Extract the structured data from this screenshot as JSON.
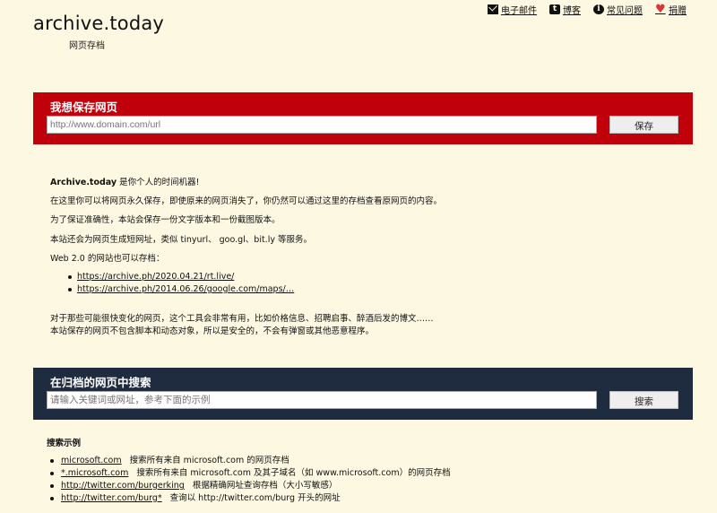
{
  "logo": {
    "title": "archive.today",
    "subtitle": "网页存档"
  },
  "topnav": [
    {
      "icon": "mail-icon",
      "label": "电子邮件"
    },
    {
      "icon": "tumblr-icon",
      "label": "博客"
    },
    {
      "icon": "info-icon",
      "label": "常见问题"
    },
    {
      "icon": "heart-icon",
      "label": "捐赠"
    }
  ],
  "save_panel": {
    "title": "我想保存网页",
    "placeholder": "http://www.domain.com/url",
    "button": "保存",
    "color": "#c0000b"
  },
  "intro": {
    "line1_bold": "Archive.today",
    "line1_rest": " 是你个人的时间机器!",
    "line2": "在这里你可以将网页永久保存，即使原来的网页消失了，你仍然可以通过这里的存档查看原网页的内容。",
    "line3": "为了保证准确性，本站会保存一份文字版本和一份截图版本。",
    "line4": "本站还会为网页生成短网址，类似 tinyurl、 goo.gl、bit.ly 等服务。",
    "line5": "Web 2.0 的网站也可以存档：",
    "links": [
      "https://archive.ph/2020.04.21/rt.live/",
      "https://archive.ph/2014.06.26/google.com/maps/…"
    ],
    "line6": "对于那些可能很快变化的网页，这个工具会非常有用，比如价格信息、招聘启事、醉酒后发的博文……",
    "line7": "本站保存的网页不包含脚本和动态对象，所以是安全的，不会有弹窗或其他恶意程序。"
  },
  "search_panel": {
    "title": "在归档的网页中搜索",
    "placeholder": "请输入关键词或网址，参考下面的示例",
    "button": "搜索",
    "color": "#1f2c40"
  },
  "examples": {
    "title": "搜索示例",
    "items": [
      {
        "link": "microsoft.com",
        "desc": "搜索所有来自 microsoft.com 的网页存档"
      },
      {
        "link": "*.microsoft.com",
        "desc": "搜索所有来自 microsoft.com 及其子域名（如 www.microsoft.com）的网页存档"
      },
      {
        "link": "http://twitter.com/burgerking",
        "desc": "根据精确网址查询存档（大小写敏感）"
      },
      {
        "link": "http://twitter.com/burg*",
        "desc": "查询以 http://twitter.com/burg 开头的网址"
      }
    ]
  }
}
